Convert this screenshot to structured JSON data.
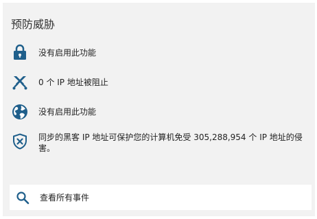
{
  "panel": {
    "title": "预防威胁",
    "items": [
      {
        "icon": "lock-icon",
        "text": "没有启用此功能"
      },
      {
        "icon": "crossed-swords-icon",
        "text": "0 个 IP 地址被阻止"
      },
      {
        "icon": "globe-icon",
        "text": "没有启用此功能"
      },
      {
        "icon": "shield-x-icon",
        "text": "同步的黑客 IP 地址可保护您的计算机免受 305,288,954 个 IP 地址的侵害。"
      }
    ],
    "view_events": {
      "icon": "search-icon",
      "label": "查看所有事件"
    }
  },
  "colors": {
    "icon_blue": "#1f5f8b",
    "panel_bg": "#f2f2f2"
  }
}
